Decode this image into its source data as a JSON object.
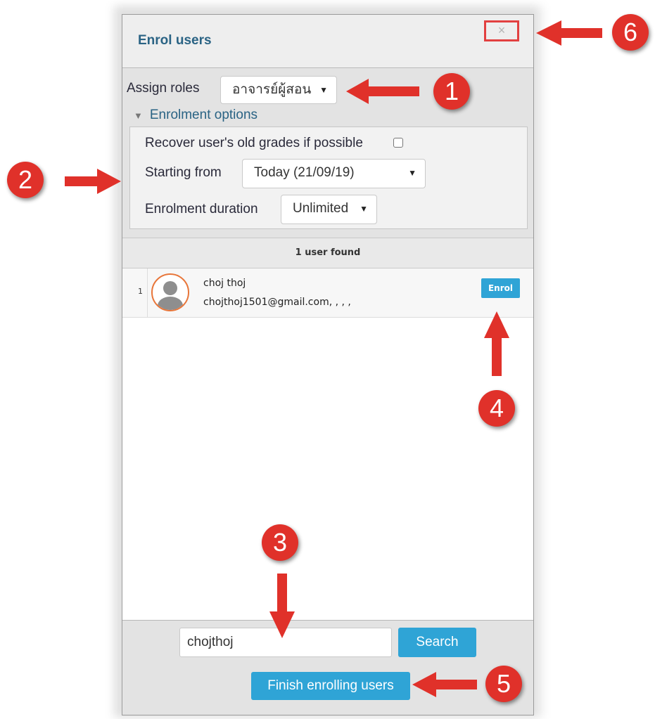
{
  "dialog": {
    "title": "Enrol users",
    "close_label": "×"
  },
  "roles": {
    "label": "Assign roles",
    "selected": "อาจารย์ผู้สอน"
  },
  "enrolment_options": {
    "toggle_label": "Enrolment options",
    "recover_label": "Recover user's old grades if possible",
    "recover_checked": false,
    "starting_label": "Starting from",
    "starting_value": "Today (21/09/19)",
    "duration_label": "Enrolment duration",
    "duration_value": "Unlimited"
  },
  "results": {
    "summary": "1 user found",
    "users": [
      {
        "index": "1",
        "name": "choj thoj",
        "email": "chojthoj1501@gmail.com, , , ,",
        "action": "Enrol"
      }
    ]
  },
  "search": {
    "value": "chojthoj",
    "button": "Search"
  },
  "finish_button": "Finish enrolling users",
  "annotations": {
    "step1": "1",
    "step2": "2",
    "step3": "3",
    "step4": "4",
    "step5": "5",
    "step6": "6"
  },
  "colors": {
    "accent": "#2fa4d6",
    "title": "#2a6384",
    "callout": "#e0312a"
  }
}
